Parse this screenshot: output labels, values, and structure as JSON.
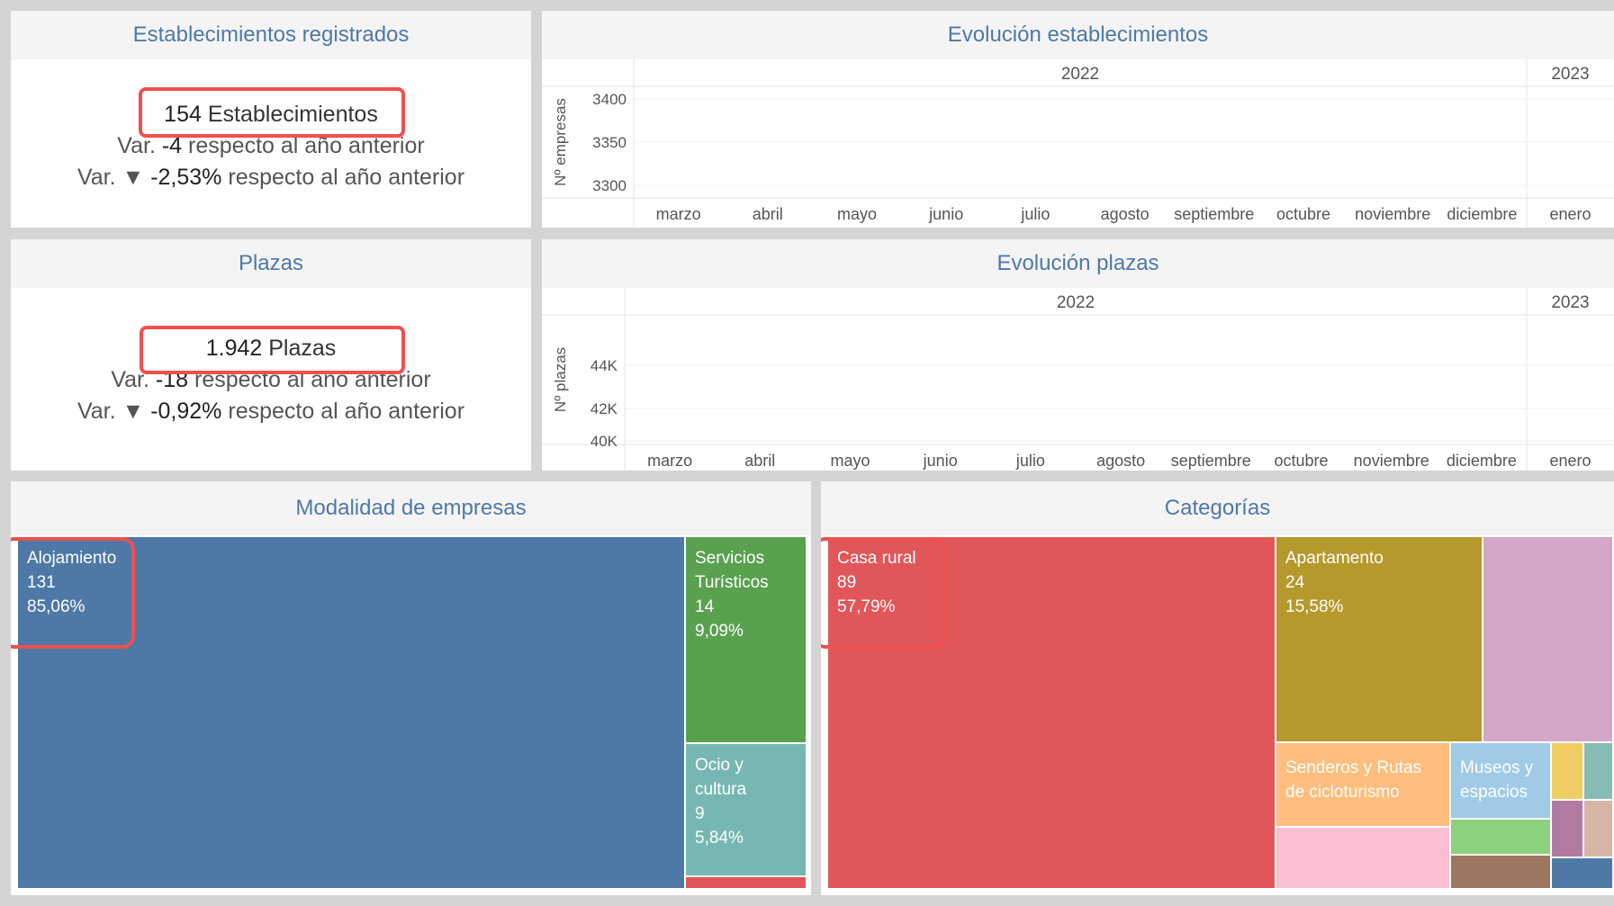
{
  "establecimientos": {
    "title": "Establecimientos registrados",
    "count": "154",
    "unit": "Establecimientos",
    "var_abs_prefix": "Var.",
    "var_abs_value": "-4",
    "var_abs_suffix": "respecto al año anterior",
    "var_pct_prefix": "Var. ▼",
    "var_pct_value": "-2,53%",
    "var_pct_suffix": "respecto al año anterior"
  },
  "plazas": {
    "title": "Plazas",
    "count": "1.942",
    "unit": "Plazas",
    "var_abs_prefix": "Var.",
    "var_abs_value": "-18",
    "var_abs_suffix": "respecto al año anterior",
    "var_pct_prefix": "Var. ▼",
    "var_pct_value": "-0,92%",
    "var_pct_suffix": "respecto al año anterior"
  },
  "evolucion_establecimientos": {
    "title": "Evolución establecimientos",
    "year_2022": "2022",
    "year_2023": "2023",
    "ylabel": "Nº empresas",
    "yticks": [
      "3400",
      "3350",
      "3300"
    ],
    "months": [
      "marzo",
      "abril",
      "mayo",
      "junio",
      "julio",
      "agosto",
      "septiembre",
      "octubre",
      "noviembre",
      "diciembre",
      "enero"
    ]
  },
  "evolucion_plazas": {
    "title": "Evolución plazas",
    "year_2022": "2022",
    "year_2023": "2023",
    "ylabel": "Nº plazas",
    "yticks": [
      "44K",
      "42K",
      "40K"
    ],
    "months": [
      "marzo",
      "abril",
      "mayo",
      "junio",
      "julio",
      "agosto",
      "septiembre",
      "octubre",
      "noviembre",
      "diciembre",
      "enero"
    ]
  },
  "modalidad": {
    "title": "Modalidad de empresas",
    "items": [
      {
        "label": "Alojamiento",
        "value": "131",
        "pct": "85,06%",
        "color": "#4e79a7"
      },
      {
        "label": "Servicios Turísticos",
        "value": "14",
        "pct": "9,09%",
        "color": "#59a14f"
      },
      {
        "label": "Ocio y cultura",
        "value": "9",
        "pct": "5,84%",
        "color": "#76b7b2"
      },
      {
        "label": "",
        "value": "",
        "pct": "",
        "color": "#e15759"
      }
    ]
  },
  "categorias": {
    "title": "Categorías",
    "items": [
      {
        "label": "Casa rural",
        "value": "89",
        "pct": "57,79%",
        "color": "#e15759"
      },
      {
        "label": "Apartamento",
        "value": "24",
        "pct": "15,58%",
        "color": "#b6992d"
      },
      {
        "label": "Senderos y Rutas de cicloturismo",
        "color": "#ffbe7d"
      },
      {
        "label": "Museos y espacios",
        "color": "#a0cbe8"
      }
    ],
    "minor_colors": [
      "#d4a6c8",
      "#fabfd2",
      "#8cd17d",
      "#9d7660",
      "#f1ce63",
      "#86bcb6",
      "#b07aa1",
      "#d7b5a6",
      "#4e79a7"
    ]
  }
}
